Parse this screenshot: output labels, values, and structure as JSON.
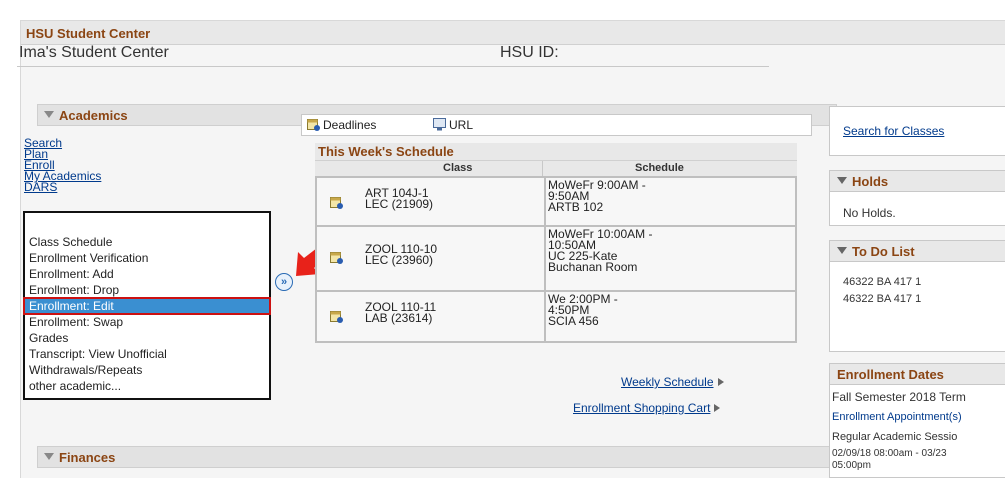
{
  "app_title": "HSU Student Center",
  "page_title": "Ima's Student Center",
  "hsu_id_label": "HSU ID:",
  "academics": {
    "section_label": "Academics",
    "links": [
      "Search",
      "Plan",
      "Enroll",
      "My Academics",
      "DARS"
    ],
    "dropdown_options": [
      "Class Schedule",
      "Enrollment Verification",
      "Enrollment: Add",
      "Enrollment: Drop",
      "Enrollment: Edit",
      "Enrollment: Swap",
      "Grades",
      "Transcript: View Unofficial",
      "Withdrawals/Repeats",
      "other academic..."
    ],
    "selected_option": "Enrollment: Edit",
    "go_button": "»"
  },
  "toolbar": {
    "deadlines": "Deadlines",
    "url": "URL"
  },
  "schedule": {
    "title": "This Week's Schedule",
    "headers": {
      "class": "Class",
      "schedule": "Schedule"
    },
    "rows": [
      {
        "class_line1": "ART 104J-1",
        "class_line2": "LEC (21909)",
        "sched": [
          "MoWeFr 9:00AM -",
          "9:50AM",
          "ARTB 102"
        ]
      },
      {
        "class_line1": "ZOOL 110-10",
        "class_line2": "LEC (23960)",
        "sched": [
          "MoWeFr 10:00AM -",
          "10:50AM",
          "UC 225-Kate",
          "Buchanan Room"
        ]
      },
      {
        "class_line1": "ZOOL 110-11",
        "class_line2": "LAB (23614)",
        "sched": [
          "We 2:00PM -",
          "4:50PM",
          "SCIA 456"
        ]
      }
    ],
    "weekly_schedule": "Weekly Schedule",
    "shopping_cart": "Enrollment Shopping Cart"
  },
  "finances": {
    "section_label": "Finances"
  },
  "right_panel": {
    "search_link": "Search for Classes",
    "holds_title": "Holds",
    "holds_text": "No Holds.",
    "todo_title": "To Do List",
    "todo_items": [
      "46322 BA 417 1",
      "46322 BA 417 1"
    ],
    "enroll_dates_title": "Enrollment Dates",
    "enroll_term": "Fall Semester 2018 Term",
    "enroll_appt": "Enrollment Appointment(s)",
    "enroll_session": "Regular Academic Sessio",
    "enroll_date_range_1": "02/09/18 08:00am - 03/23",
    "enroll_date_range_2": "05:00pm"
  },
  "colors": {
    "accent": "#8b4513",
    "link": "#003a8c",
    "selected": "#3a8fd1",
    "highlight": "#cc1111"
  }
}
